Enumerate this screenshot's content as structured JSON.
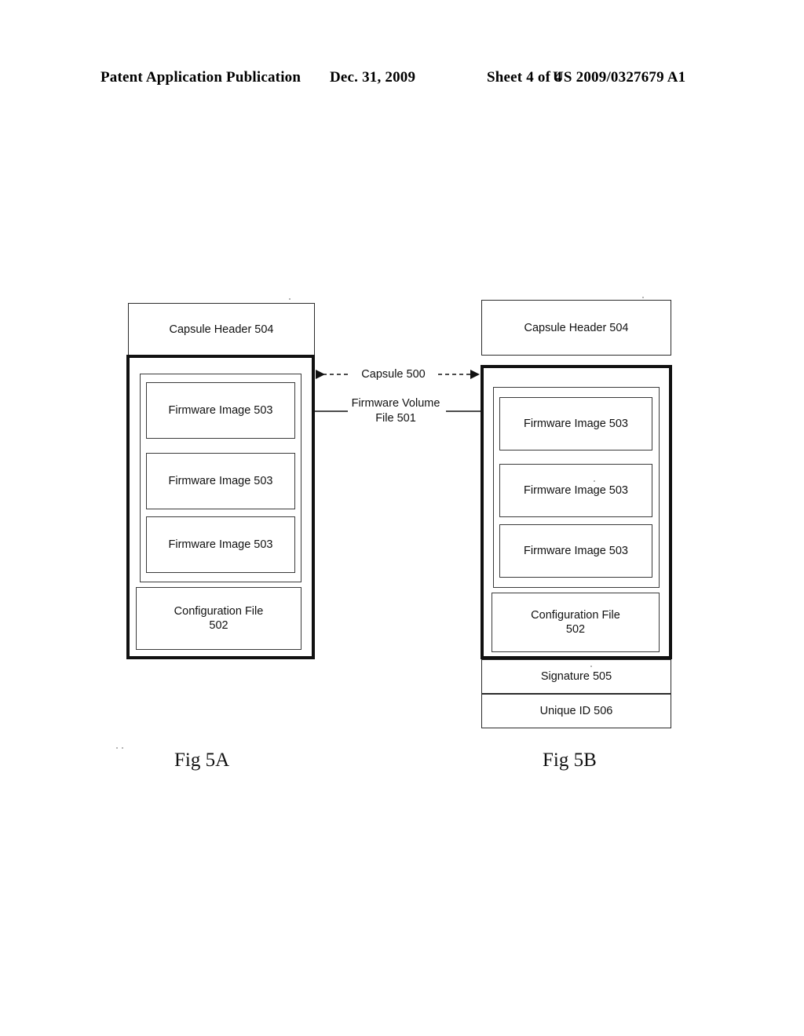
{
  "page_header": {
    "left": "Patent Application Publication",
    "date": "Dec. 31, 2009",
    "sheet": "Sheet 4 of 4",
    "publication_number": "US 2009/0327679 A1"
  },
  "annotations": {
    "capsule": "Capsule 500",
    "firmware_volume_file": "Firmware Volume\nFile 501"
  },
  "fig_a": {
    "caption": "Fig 5A",
    "capsule_header": "Capsule Header 504",
    "firmware_images": [
      "Firmware Image 503",
      "Firmware Image 503",
      "Firmware Image 503"
    ],
    "configuration_file": "Configuration File\n502"
  },
  "fig_b": {
    "caption": "Fig 5B",
    "capsule_header": "Capsule Header 504",
    "firmware_images": [
      "Firmware Image 503",
      "Firmware Image 503",
      "Firmware Image 503"
    ],
    "configuration_file": "Configuration File\n502",
    "signature": "Signature 505",
    "unique_id": "Unique ID 506"
  },
  "colors": {
    "ink": "#111111",
    "thin_border": "#3a3a3a",
    "paper": "#ffffff"
  }
}
